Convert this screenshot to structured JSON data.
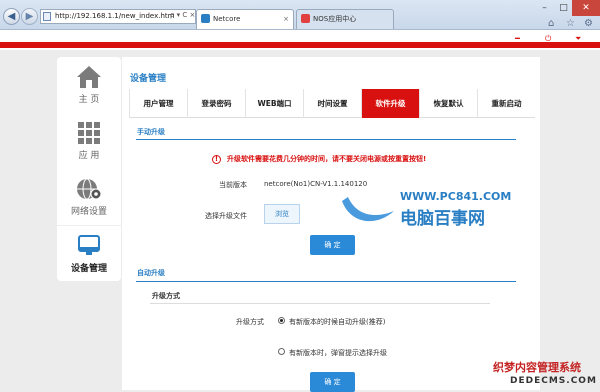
{
  "browser": {
    "address": "http://192.168.1.1/new_index.htm",
    "addr_tools": "ρ ▾ C ×",
    "tabs": [
      {
        "label": "Netcore",
        "active": true
      },
      {
        "label": "NOS应用中心",
        "active": false
      }
    ]
  },
  "sidebar": {
    "items": [
      {
        "label": "主 页",
        "icon": "home-icon"
      },
      {
        "label": "应 用",
        "icon": "grid-icon"
      },
      {
        "label": "网络设置",
        "icon": "globe-gear-icon"
      },
      {
        "label": "设备管理",
        "icon": "monitor-icon",
        "active": true
      }
    ]
  },
  "main": {
    "title": "设备管理",
    "tabs": [
      "用户管理",
      "登录密码",
      "WEB端口",
      "时间设置",
      "软件升级",
      "恢复默认",
      "重新启动"
    ],
    "active_tab": "软件升级",
    "manual": {
      "title": "手动升级",
      "warning": "升级软件需要花费几分钟的时间，请不要关闭电源或按重置按钮!",
      "version_label": "当前版本",
      "version_value": "netcore(No1)CN-V1.1.140120",
      "file_label": "选择升级文件",
      "browse": "浏览",
      "ok": "确 定"
    },
    "auto": {
      "title": "自动升级",
      "subtitle": "升级方式",
      "mode_label": "升级方式",
      "option1": "有新版本的时候自动升级(推荐)",
      "option2": "有新版本时，弹窗提示选择升级",
      "ok": "确 定"
    }
  },
  "watermarks": {
    "site_url": "WWW.PC841.COM",
    "site_name": "电脑百事网",
    "dede_name": "织梦内容管理系统",
    "dede_url": "DEDECMS.COM"
  },
  "colors": {
    "accent_red": "#d8100f",
    "accent_blue": "#2a8ad8"
  }
}
